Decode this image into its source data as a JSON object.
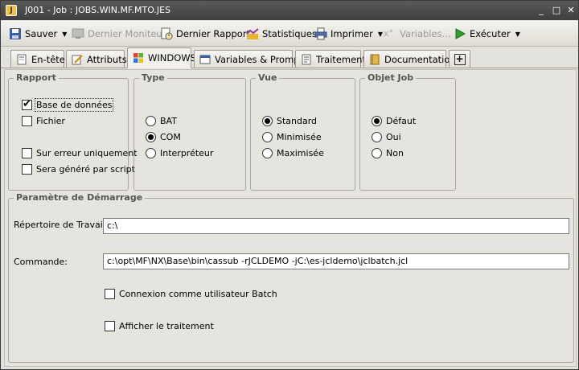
{
  "window": {
    "title": "J001 - Job : JOBS.WIN.MF.MTO.JES",
    "minimize": "_",
    "maximize": "□",
    "close": "✕"
  },
  "toolbar": {
    "save": "Sauver",
    "last_monitor": "Dernier Moniteur",
    "last_report": "Dernier Rapport",
    "statistics": "Statistiques",
    "print": "Imprimer",
    "variables": "Variables...",
    "execute": "Exécuter"
  },
  "tabs": {
    "header": "En-tête",
    "attributes": "Attributs",
    "windows": "WINDOWS",
    "variables_prompts": "Variables & Prompts",
    "processing": "Traitement",
    "documentation": "Documentation",
    "add": "+"
  },
  "rapport": {
    "legend": "Rapport",
    "database": "Base de données",
    "file": "Fichier",
    "on_error": "Sur erreur uniquement",
    "by_script": "Sera généré par script"
  },
  "type": {
    "legend": "Type",
    "bat": "BAT",
    "com": "COM",
    "interpreter": "Interpréteur"
  },
  "vue": {
    "legend": "Vue",
    "standard": "Standard",
    "minimized": "Minimisée",
    "maximized": "Maximisée"
  },
  "objet_job": {
    "legend": "Objet Job",
    "default": "Défaut",
    "yes": "Oui",
    "no": "Non"
  },
  "startup": {
    "legend": "Paramètre de Démarrage",
    "workdir_label": "Répertoire de Travail:",
    "workdir_value": "c:\\",
    "command_label": "Commande:",
    "command_value": "c:\\opt\\MF\\NX\\Base\\bin\\cassub -rJCLDEMO -jC:\\es-jcldemo\\jclbatch.jcl",
    "batch_user": "Connexion comme utilisateur Batch",
    "show_processing": "Afficher le traitement"
  }
}
